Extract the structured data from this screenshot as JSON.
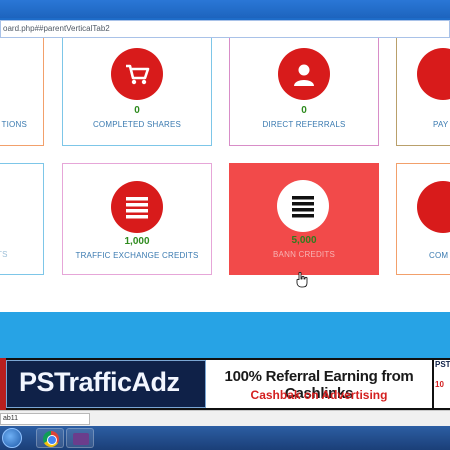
{
  "browser": {
    "url_fragment": "oard.php##parentVerticalTab2"
  },
  "row1": [
    {
      "value": "",
      "label": "TIONS"
    },
    {
      "value": "0",
      "label": "COMPLETED SHARES"
    },
    {
      "value": "0",
      "label": "DIRECT REFERRALS"
    },
    {
      "value": "",
      "label": "PAY"
    }
  ],
  "row2": [
    {
      "value": "",
      "label": "TS"
    },
    {
      "value": "1,000",
      "label": "TRAFFIC EXCHANGE CREDITS"
    },
    {
      "value": "5,000",
      "label": "BANNER CREDITS",
      "label_visible": "BANN  CREDITS"
    },
    {
      "value": "",
      "label": "COM"
    }
  ],
  "banner": {
    "logo": "PSTrafficAdz",
    "headline": "100% Referral Earning from Cashlinks",
    "subline": "Cashbak on Advertising",
    "right_fragment": "PST",
    "right_fragment_2": "10"
  },
  "status": {
    "tab_text": "ab11"
  },
  "colors": {
    "accent_red": "#d81b1b",
    "highlight_card": "#f24a4a",
    "value_green": "#2e8b1e",
    "label_blue": "#3a7ab0",
    "band_blue": "#27a3e5"
  }
}
